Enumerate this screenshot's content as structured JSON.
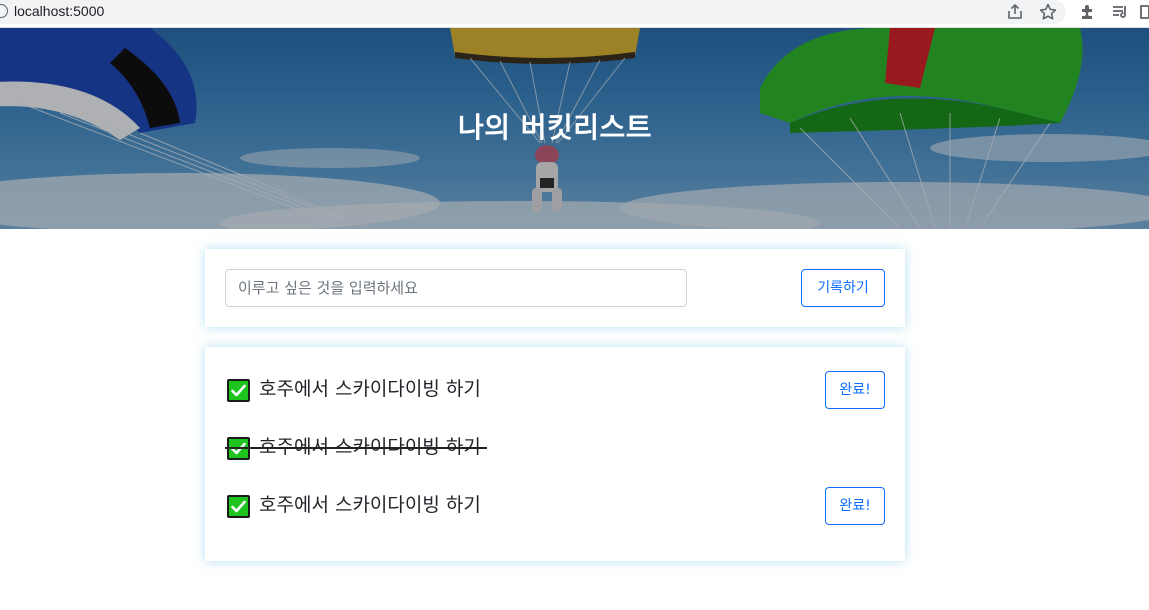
{
  "browser": {
    "url": "localhost:5000",
    "icons": [
      "site-info-icon",
      "share-icon",
      "star-icon",
      "extensions-icon",
      "reading-list-icon",
      "side-panel-icon"
    ]
  },
  "hero": {
    "title": "나의 버킷리스트"
  },
  "form": {
    "placeholder": "이루고 싶은 것을 입력하세요",
    "value": "",
    "save_label": "기록하기"
  },
  "list": {
    "items": [
      {
        "text": "호주에서 스카이다이빙 하기",
        "done": false,
        "button_label": "완료!"
      },
      {
        "text": "호주에서 스카이다이빙 하기",
        "done": true
      },
      {
        "text": "호주에서 스카이다이빙 하기",
        "done": false,
        "button_label": "완료!"
      }
    ]
  },
  "colors": {
    "primary": "#0d6efd",
    "check_green": "#1ec31e",
    "card_glow": "#72c4e8"
  }
}
